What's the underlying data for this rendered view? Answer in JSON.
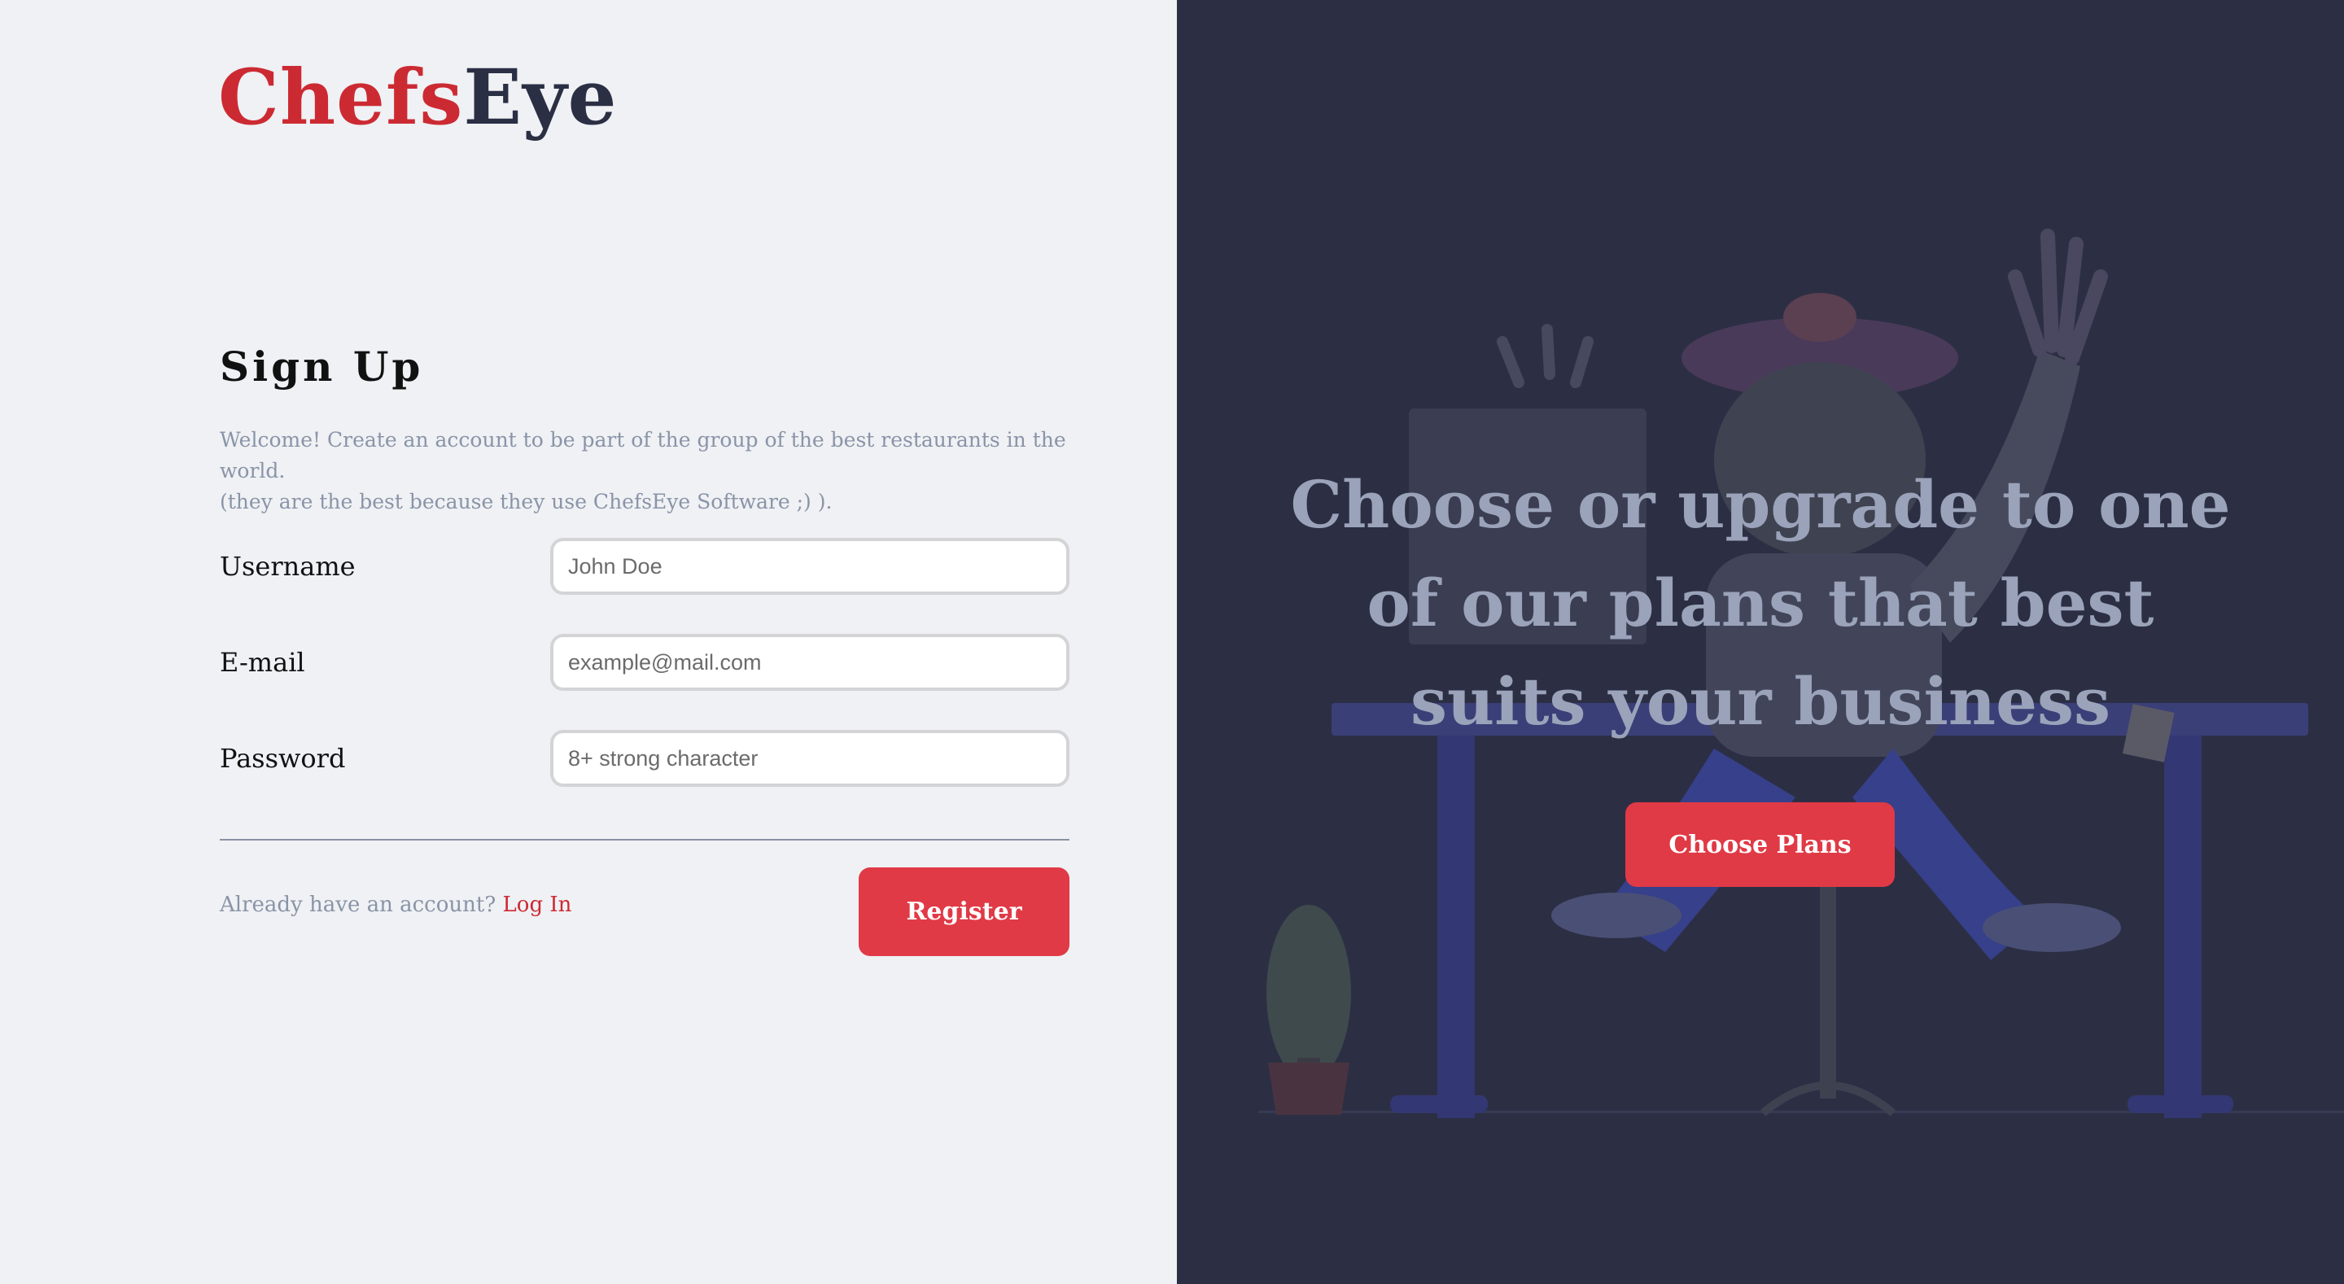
{
  "brand": {
    "logo_part1": "Chefs",
    "logo_part2": "Eye",
    "colors": {
      "red": "#cc2a33",
      "navy": "#2b2f44",
      "button": "#e03a46",
      "muted_text": "#8a94a8",
      "panel_bg": "#2c2f44"
    }
  },
  "signup": {
    "title": "Sign Up",
    "welcome_line1": "Welcome! Create an account to be part of the group of the best restaurants in the world.",
    "welcome_line2": "(they are the best because they use ChefsEye Software ;) ).",
    "fields": [
      {
        "label": "Username",
        "placeholder": "John Doe"
      },
      {
        "label": "E-mail",
        "placeholder": "example@mail.com"
      },
      {
        "label": "Password",
        "placeholder": "8+ strong character"
      }
    ],
    "login_prompt": "Already have an account?",
    "login_link": "Log In",
    "register_label": "Register"
  },
  "promo": {
    "headline_line1": "Choose or upgrade to one",
    "headline_line2": "of our plans that best",
    "headline_line3": "suits your business",
    "button_label": "Choose Plans",
    "illustration": "chef-at-desk-illustration"
  }
}
